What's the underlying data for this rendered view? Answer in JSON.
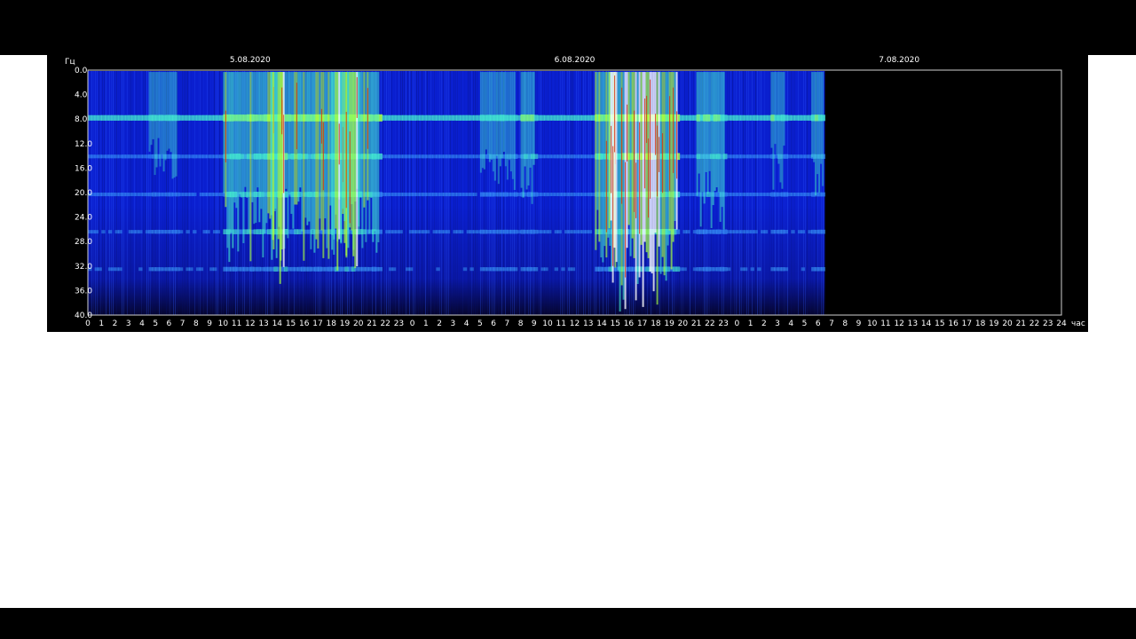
{
  "chart_data": {
    "type": "heatmap",
    "y_unit": "Гц",
    "x_unit": "час",
    "ylim": [
      0,
      40
    ],
    "y_ticks": [
      "0.0",
      "4.0",
      "8.0",
      "12.0",
      "16.0",
      "20.0",
      "24.0",
      "28.0",
      "32.0",
      "36.0",
      "40.0"
    ],
    "dates": [
      "5.08.2020",
      "6.08.2020",
      "7.08.2020"
    ],
    "hour_ticks": [
      "0",
      "1",
      "2",
      "3",
      "4",
      "5",
      "6",
      "7",
      "8",
      "9",
      "10",
      "11",
      "12",
      "13",
      "14",
      "15",
      "16",
      "17",
      "18",
      "19",
      "20",
      "21",
      "22",
      "23",
      "24"
    ],
    "xlim_hours": [
      0,
      72
    ],
    "data_end_hour": 54.5,
    "colors": {
      "background": "#05052e",
      "low": "#0a1fd0",
      "mid": "#45f0d0",
      "high": "#a8ff40",
      "peak": "#d83010",
      "max": "#ffffff"
    },
    "harmonic_bands_hz": [
      7.8,
      14.1,
      20.3,
      26.4,
      32.5
    ],
    "activity_events": [
      {
        "start_hour": 4.5,
        "end_hour": 6.5,
        "intensity": 0.35
      },
      {
        "start_hour": 10.0,
        "end_hour": 21.5,
        "intensity": 0.75
      },
      {
        "start_hour": 13.5,
        "end_hour": 14.5,
        "intensity": 0.95
      },
      {
        "start_hour": 18.0,
        "end_hour": 20.0,
        "intensity": 0.9
      },
      {
        "start_hour": 29.0,
        "end_hour": 31.5,
        "intensity": 0.4
      },
      {
        "start_hour": 32.0,
        "end_hour": 33.0,
        "intensity": 0.5
      },
      {
        "start_hour": 37.5,
        "end_hour": 39.0,
        "intensity": 0.8
      },
      {
        "start_hour": 38.5,
        "end_hour": 43.5,
        "intensity": 1.0
      },
      {
        "start_hour": 45.0,
        "end_hour": 47.0,
        "intensity": 0.6
      },
      {
        "start_hour": 50.5,
        "end_hour": 51.5,
        "intensity": 0.4
      },
      {
        "start_hour": 53.5,
        "end_hour": 54.3,
        "intensity": 0.45
      }
    ]
  }
}
